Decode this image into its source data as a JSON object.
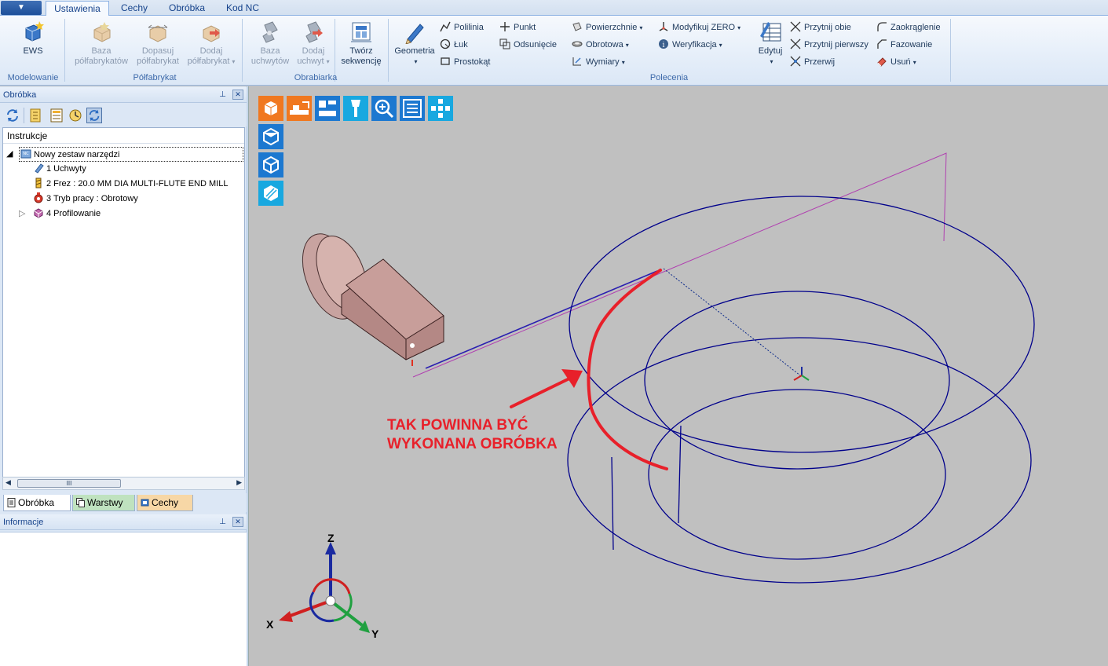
{
  "app_menu": {
    "label": ""
  },
  "tabs": [
    "Ustawienia",
    "Cechy",
    "Obróbka",
    "Kod NC"
  ],
  "ribbon": {
    "groups": [
      "Modelowanie",
      "Półfabrykat",
      "Obrabiarka",
      "Polecenia"
    ],
    "ews": "EWS",
    "baza_polf": [
      "Baza",
      "półfabrykatów"
    ],
    "dopasuj": [
      "Dopasuj",
      "półfabrykat"
    ],
    "dodaj_polf": [
      "Dodaj",
      "półfabrykat"
    ],
    "baza_uchw": [
      "Baza",
      "uchwytów"
    ],
    "dodaj_uchw": [
      "Dodaj",
      "uchwyt"
    ],
    "tworz": [
      "Twórz",
      "sekwencję"
    ],
    "geometria": "Geometria",
    "polilinia": "Polilinia",
    "luk": "Łuk",
    "prostokat": "Prostokąt",
    "punkt": "Punkt",
    "odsuniecie": "Odsunięcie",
    "powierzchnie": "Powierzchnie",
    "obrotowa": "Obrotowa",
    "wymiary": "Wymiary",
    "modyfikuj": "Modyfikuj ZERO",
    "weryfikacja": "Weryfikacja",
    "edytuj": "Edytuj",
    "przytnij_obie": "Przytnij obie",
    "przytnij_pierwszy": "Przytnij pierwszy",
    "przerwij": "Przerwij",
    "zaokraglenie": "Zaokrąglenie",
    "fazowanie": "Fazowanie",
    "usun": "Usuń"
  },
  "left_panel": {
    "title": "Obróbka",
    "tree_header": "Instrukcje",
    "root": "Nowy zestaw narzędzi",
    "items": [
      "1 Uchwyty",
      "2 Frez : 20.0 MM DIA MULTI-FLUTE END MILL",
      "3 Tryb pracy : Obrotowy",
      "4 Profilowanie"
    ],
    "scroll_glyph": "III",
    "bottom_tabs": [
      "Obróbka",
      "Warstwy",
      "Cechy"
    ],
    "info_title": "Informacje"
  },
  "viewport": {
    "annotation": [
      "TAK POWINNA BYĆ",
      "WYKONANA OBRÓBKA"
    ],
    "axes": {
      "z": "Z",
      "x": "X",
      "y": "Y"
    }
  },
  "colors": {
    "accent": "#15428b",
    "wire": "#00008b",
    "annotation": "#e8202a",
    "path": "#b040b0"
  }
}
